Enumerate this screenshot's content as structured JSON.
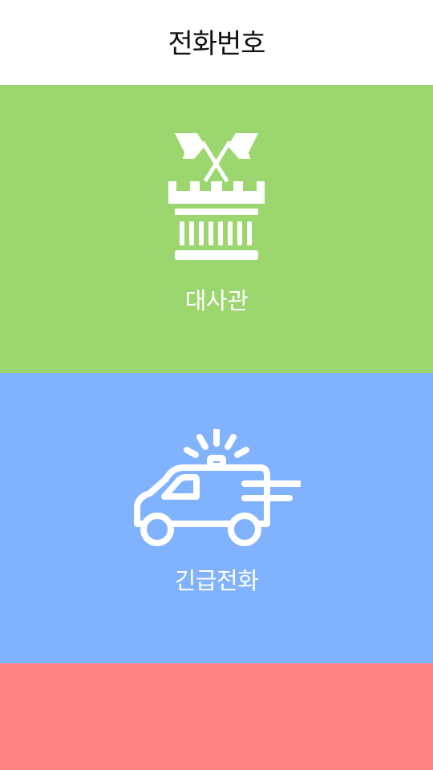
{
  "header": {
    "title": "전화번호"
  },
  "tiles": [
    {
      "label": "대사관",
      "icon": "embassy-building-icon",
      "color": "#9bd66f"
    },
    {
      "label": "긴급전화",
      "icon": "ambulance-icon",
      "color": "#80b2fd"
    },
    {
      "label": "",
      "icon": "",
      "color": "#ff8383"
    }
  ]
}
